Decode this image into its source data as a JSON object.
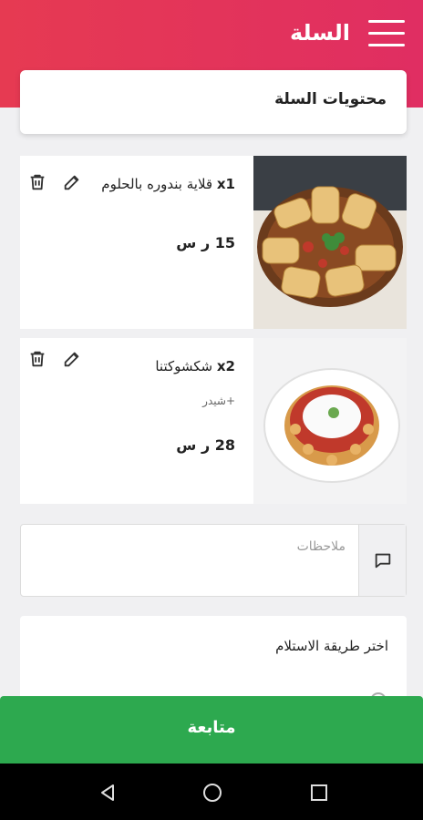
{
  "header": {
    "title": "السلة"
  },
  "cart_title": "محتويات السلة",
  "items": [
    {
      "qty": "x1",
      "name": "قلاية بندوره بالحلوم",
      "extra": "",
      "price": "15 ر س"
    },
    {
      "qty": "x2",
      "name": "شكشوكتنا",
      "extra": "+شيدر",
      "price": "28 ر س"
    }
  ],
  "notes": {
    "placeholder": "ملاحظات"
  },
  "pickup": {
    "title": "اختر طريقة الاستلام"
  },
  "continue_label": "متابعة",
  "colors": {
    "header_start": "#e63a52",
    "header_end": "#e02e62",
    "continue": "#2da94f"
  }
}
